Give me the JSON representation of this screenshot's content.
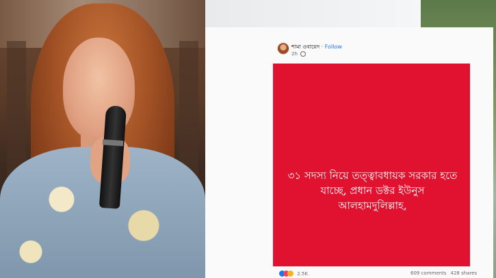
{
  "post": {
    "author": "শামা ওবায়েদ",
    "separator": "·",
    "follow_label": "Follow",
    "time": "2h",
    "body_line1": "৩১ সদস্য নিয়ে তত্ত্বাবধায়ক সরকার হতে",
    "body_line2": "যাচ্ছে, প্রধান ডক্টর ইউনুস",
    "body_line3": "আলহামদুলিল্লাহ,",
    "background_color": "#e0122f"
  },
  "stats": {
    "reaction_count": "2.5K",
    "comments": "609 comments",
    "shares": "428 shares",
    "reaction_icons": [
      "like-icon",
      "love-icon",
      "wow-icon"
    ]
  }
}
